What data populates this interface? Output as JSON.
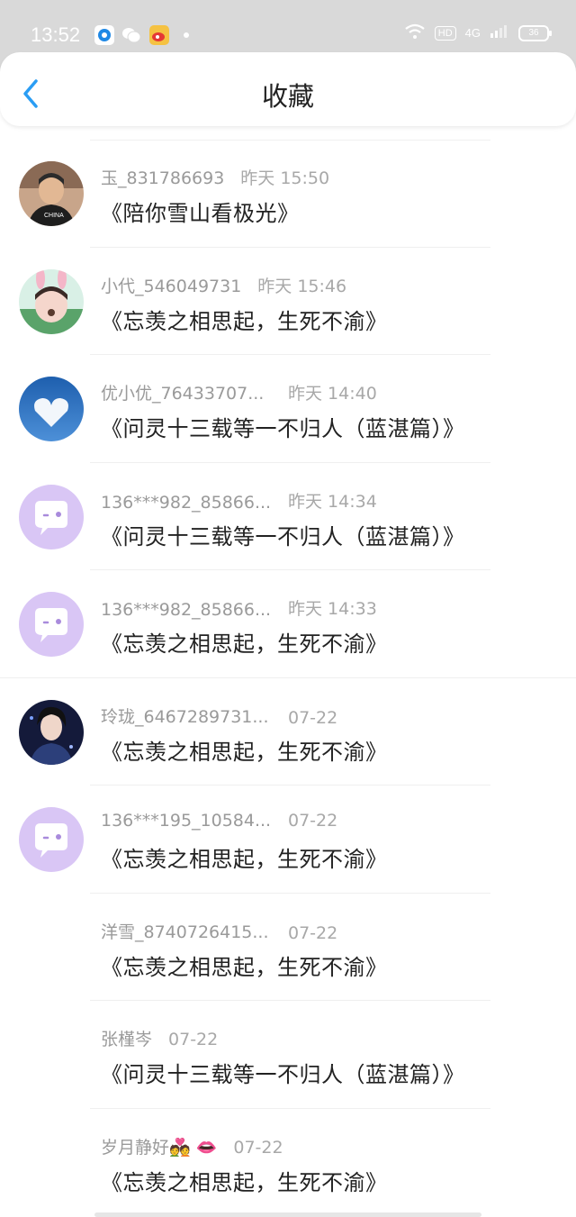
{
  "status_bar": {
    "time": "13:52",
    "hd_label": "HD",
    "network_label": "4G",
    "battery": "36"
  },
  "header": {
    "title": "收藏"
  },
  "items": [
    {
      "user": "玉_831786693",
      "time": "昨天 15:50",
      "title": "《陪你雪山看极光》",
      "avatar": "boy-photo"
    },
    {
      "user": "小代_546049731",
      "time": "昨天 15:46",
      "title": "《忘羡之相思起，生死不渝》",
      "avatar": "bunny-girl-photo"
    },
    {
      "user": "优小优_76433707...",
      "time": "昨天 14:40",
      "title": "《问灵十三载等一不归人（蓝湛篇）》",
      "avatar": "heart-cloud-photo"
    },
    {
      "user": "136***982_85866...",
      "time": "昨天 14:34",
      "title": "《问灵十三载等一不归人（蓝湛篇）》",
      "avatar": "default-chat-avatar"
    },
    {
      "user": "136***982_85866...",
      "time": "昨天 14:33",
      "title": "《忘羡之相思起，生死不渝》",
      "avatar": "default-chat-avatar"
    },
    {
      "user": "玲珑_6467289731...",
      "time": "07-22",
      "title": "《忘羡之相思起，生死不渝》",
      "avatar": "anime-man-photo"
    },
    {
      "user": "136***195_10584...",
      "time": "07-22",
      "title": "《忘羡之相思起，生死不渝》",
      "avatar": "default-chat-avatar"
    },
    {
      "user": "洋雪_8740726415...",
      "time": "07-22",
      "title": "《忘羡之相思起，生死不渝》",
      "avatar": "none"
    },
    {
      "user": "张槿岑",
      "time": "07-22",
      "title": "《问灵十三载等一不归人（蓝湛篇）》",
      "avatar": "none"
    },
    {
      "user": "岁月静好💑 👄",
      "time": "07-22",
      "title": "《忘羡之相思起，生死不渝》",
      "avatar": "none"
    }
  ],
  "colors": {
    "accent": "#2a9df4",
    "default_avatar_bg": "#d9c6f5",
    "status_bar_bg": "#d9d9d9"
  }
}
